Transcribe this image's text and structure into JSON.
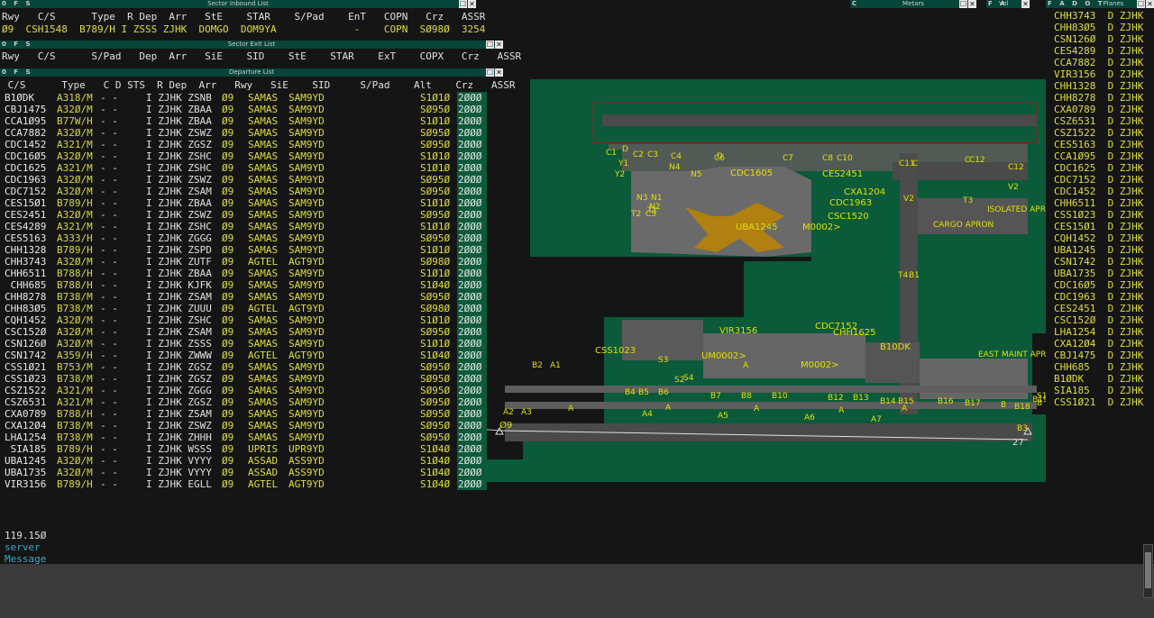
{
  "windows": {
    "inbound": {
      "title": "Sector Inbound List",
      "controls": "0 F S"
    },
    "exit": {
      "title": "Sector Exit List",
      "controls": "0 F S"
    },
    "departure": {
      "title": "Departure List",
      "controls": "0 F S"
    },
    "metars": {
      "title": "Metars",
      "controls": "C"
    },
    "vol": {
      "title": "Vol",
      "controls": "F A"
    },
    "planes": {
      "title": "Planes",
      "controls": "F A D O T"
    },
    "close_glyph": "✕",
    "expand_glyph": "☐"
  },
  "inbound_list": {
    "header": "Rwy   C/S      Type  R Dep  Arr   StE    STAR    S/Pad    EnT   COPN   Crz   ASSR",
    "row": "Ø9  CSH1548  B789/H I ZSSS ZJHK  DOMGO  DOM9YA             -    COPN  SØ98Ø  3254"
  },
  "exit_list": {
    "header": "Rwy   C/S      S/Pad   Dep  Arr   SiE    SID    StE    STAR    ExT    COPX   Crz   ASSR"
  },
  "departure_list": {
    "header": " C/S      Type   C D STS  R Dep  Arr   Rwy   SiE    SID     S/Pad    Alt    Crz   ASSR",
    "rows": [
      [
        "B1ØDK",
        "A318/M",
        "- -",
        "I ZJHK ZSNB",
        "Ø9",
        "SAMAS",
        "SAM9YD",
        "S1Ø1Ø",
        "2ØØØ"
      ],
      [
        "CBJ1475",
        "A32Ø/M",
        "- -",
        "I ZJHK ZBAA",
        "Ø9",
        "SAMAS",
        "SAM9YD",
        "SØ95Ø",
        "2ØØØ"
      ],
      [
        "CCA1Ø95",
        "B77W/H",
        "- -",
        "I ZJHK ZBAA",
        "Ø9",
        "SAMAS",
        "SAM9YD",
        "S1Ø1Ø",
        "2ØØØ"
      ],
      [
        "CCA7882",
        "A32Ø/M",
        "- -",
        "I ZJHK ZSWZ",
        "Ø9",
        "SAMAS",
        "SAM9YD",
        "SØ95Ø",
        "2ØØØ"
      ],
      [
        "CDC1452",
        "A321/M",
        "- -",
        "I ZJHK ZGSZ",
        "Ø9",
        "SAMAS",
        "SAM9YD",
        "SØ95Ø",
        "2ØØØ"
      ],
      [
        "CDC16Ø5",
        "A32Ø/M",
        "- -",
        "I ZJHK ZSHC",
        "Ø9",
        "SAMAS",
        "SAM9YD",
        "S1Ø1Ø",
        "2ØØØ"
      ],
      [
        "CDC1625",
        "A321/M",
        "- -",
        "I ZJHK ZSHC",
        "Ø9",
        "SAMAS",
        "SAM9YD",
        "S1Ø1Ø",
        "2ØØØ"
      ],
      [
        "CDC1963",
        "A32Ø/M",
        "- -",
        "I ZJHK ZSWZ",
        "Ø9",
        "SAMAS",
        "SAM9YD",
        "SØ95Ø",
        "2ØØØ"
      ],
      [
        "CDC7152",
        "A32Ø/M",
        "- -",
        "I ZJHK ZSAM",
        "Ø9",
        "SAMAS",
        "SAM9YD",
        "SØ95Ø",
        "2ØØØ"
      ],
      [
        "CES15Ø1",
        "B789/H",
        "- -",
        "I ZJHK ZBAA",
        "Ø9",
        "SAMAS",
        "SAM9YD",
        "S1Ø1Ø",
        "2ØØØ"
      ],
      [
        "CES2451",
        "A32Ø/M",
        "- -",
        "I ZJHK ZSWZ",
        "Ø9",
        "SAMAS",
        "SAM9YD",
        "SØ95Ø",
        "2ØØØ"
      ],
      [
        "CES4289",
        "A321/M",
        "- -",
        "I ZJHK ZSHC",
        "Ø9",
        "SAMAS",
        "SAM9YD",
        "S1Ø1Ø",
        "2ØØØ"
      ],
      [
        "CES5163",
        "A333/H",
        "- -",
        "I ZJHK ZGGG",
        "Ø9",
        "SAMAS",
        "SAM9YD",
        "SØ95Ø",
        "2ØØØ"
      ],
      [
        "CHH1328",
        "B789/H",
        "- -",
        "I ZJHK ZSPD",
        "Ø9",
        "SAMAS",
        "SAM9YD",
        "S1Ø1Ø",
        "2ØØØ"
      ],
      [
        "CHH3743",
        "A32Ø/M",
        "- -",
        "I ZJHK ZUTF",
        "Ø9",
        "AGTEL",
        "AGT9YD",
        "SØ98Ø",
        "2ØØØ"
      ],
      [
        "CHH6511",
        "B788/H",
        "- -",
        "I ZJHK ZBAA",
        "Ø9",
        "SAMAS",
        "SAM9YD",
        "S1Ø1Ø",
        "2ØØØ"
      ],
      [
        " CHH685",
        "B788/H",
        "- -",
        "I ZJHK KJFK",
        "Ø9",
        "SAMAS",
        "SAM9YD",
        "S1Ø4Ø",
        "2ØØØ"
      ],
      [
        "CHH8278",
        "B738/M",
        "- -",
        "I ZJHK ZSAM",
        "Ø9",
        "SAMAS",
        "SAM9YD",
        "SØ95Ø",
        "2ØØØ"
      ],
      [
        "CHH83Ø5",
        "B738/M",
        "- -",
        "I ZJHK ZUUU",
        "Ø9",
        "AGTEL",
        "AGT9YD",
        "SØ98Ø",
        "2ØØØ"
      ],
      [
        "CQH1452",
        "A32Ø/M",
        "- -",
        "I ZJHK ZSHC",
        "Ø9",
        "SAMAS",
        "SAM9YD",
        "S1Ø1Ø",
        "2ØØØ"
      ],
      [
        "CSC152Ø",
        "A32Ø/M",
        "- -",
        "I ZJHK ZSAM",
        "Ø9",
        "SAMAS",
        "SAM9YD",
        "SØ95Ø",
        "2ØØØ"
      ],
      [
        "CSN126Ø",
        "A32Ø/M",
        "- -",
        "I ZJHK ZSSS",
        "Ø9",
        "SAMAS",
        "SAM9YD",
        "S1Ø1Ø",
        "2ØØØ"
      ],
      [
        "CSN1742",
        "A359/H",
        "- -",
        "I ZJHK ZWWW",
        "Ø9",
        "AGTEL",
        "AGT9YD",
        "S1Ø4Ø",
        "2ØØØ"
      ],
      [
        "CSS1Ø21",
        "B753/M",
        "- -",
        "I ZJHK ZGSZ",
        "Ø9",
        "SAMAS",
        "SAM9YD",
        "SØ95Ø",
        "2ØØØ"
      ],
      [
        "CSS1Ø23",
        "B738/M",
        "- -",
        "I ZJHK ZGSZ",
        "Ø9",
        "SAMAS",
        "SAM9YD",
        "SØ95Ø",
        "2ØØØ"
      ],
      [
        "CSZ1522",
        "A321/M",
        "- -",
        "I ZJHK ZGGG",
        "Ø9",
        "SAMAS",
        "SAM9YD",
        "SØ95Ø",
        "2ØØØ"
      ],
      [
        "CSZ6531",
        "A321/M",
        "- -",
        "I ZJHK ZGSZ",
        "Ø9",
        "SAMAS",
        "SAM9YD",
        "SØ95Ø",
        "2ØØØ"
      ],
      [
        "CXA0789",
        "B788/H",
        "- -",
        "I ZJHK ZSAM",
        "Ø9",
        "SAMAS",
        "SAM9YD",
        "SØ95Ø",
        "2ØØØ"
      ],
      [
        "CXA12Ø4",
        "B738/M",
        "- -",
        "I ZJHK ZSWZ",
        "Ø9",
        "SAMAS",
        "SAM9YD",
        "SØ95Ø",
        "2ØØØ"
      ],
      [
        "LHA1254",
        "B738/M",
        "- -",
        "I ZJHK ZHHH",
        "Ø9",
        "SAMAS",
        "SAM9YD",
        "SØ95Ø",
        "2ØØØ"
      ],
      [
        " SIA185",
        "B789/H",
        "- -",
        "I ZJHK WSSS",
        "Ø9",
        "UPRIS",
        "UPR9YD",
        "S1Ø4Ø",
        "2ØØØ"
      ],
      [
        "UBA1245",
        "A32Ø/M",
        "- -",
        "I ZJHK VYYY",
        "Ø9",
        "ASSAD",
        "ASS9YD",
        "S1Ø4Ø",
        "2ØØØ"
      ],
      [
        "UBA1735",
        "A32Ø/M",
        "- -",
        "I ZJHK VYYY",
        "Ø9",
        "ASSAD",
        "ASS9YD",
        "S1Ø4Ø",
        "2ØØØ"
      ],
      [
        "VIR3156",
        "B789/H",
        "- -",
        "I ZJHK EGLL",
        "Ø9",
        "AGTEL",
        "AGT9YD",
        "S1Ø4Ø",
        "2ØØØ"
      ]
    ]
  },
  "planes": [
    "CHH3743  D ZJHK",
    "CHH83Ø5  D ZJHK",
    "CSN126Ø  D ZJHK",
    "CES4289  D ZJHK",
    "CCA7882  D ZJHK",
    "VIR3156  D ZJHK",
    "CHH1328  D ZJHK",
    "CHH8278  D ZJHK",
    "CXA0789  D ZJHK",
    "CSZ6531  D ZJHK",
    "CSZ1522  D ZJHK",
    "CES5163  D ZJHK",
    "CCA1Ø95  D ZJHK",
    "CDC1625  D ZJHK",
    "CDC7152  D ZJHK",
    "CDC1452  D ZJHK",
    "CHH6511  D ZJHK",
    "CSS1Ø23  D ZJHK",
    "CES15Ø1  D ZJHK",
    "CQH1452  D ZJHK",
    "UBA1245  D ZJHK",
    "CSN1742  D ZJHK",
    "UBA1735  D ZJHK",
    "CDC16Ø5  D ZJHK",
    "CDC1963  D ZJHK",
    "CES2451  D ZJHK",
    "CSC152Ø  D ZJHK",
    "LHA1254  D ZJHK",
    "CXA12Ø4  D ZJHK",
    "CBJ1475  D ZJHK",
    "CHH685   D ZJHK",
    "B1ØDK    D ZJHK",
    "SIA185   D ZJHK",
    "CSS1Ø21  D ZJHK"
  ],
  "map": {
    "labels": {
      "cargo_apron": "CARGO APRON",
      "isolated_apron": "ISOLATED APRON",
      "east_maint_apron": "EAST MAINT APRON",
      "rwy_09": "Ø9",
      "rwy_27": "27",
      "twy": [
        "C1",
        "Y1",
        "Y2",
        "D",
        "C2",
        "C3",
        "C4",
        "N4",
        "N5",
        "N3",
        "N1",
        "N2",
        "T1",
        "T2",
        "C5",
        "C6",
        "D",
        "C7",
        "C8",
        "C10",
        "C11",
        "C",
        "C",
        "C12",
        "C12",
        "V2",
        "V2",
        "T3",
        "T4",
        "B1",
        "B2",
        "A1",
        "A2",
        "A3",
        "A4",
        "A5",
        "A6",
        "A7",
        "B3",
        "B4",
        "B5",
        "B6",
        "B7",
        "B8",
        "B10",
        "B12",
        "B13",
        "B14",
        "B15",
        "B16",
        "B17",
        "B",
        "B18",
        "B19",
        "S1",
        "S2",
        "S3",
        "S4",
        "A",
        "A",
        "A",
        "A",
        "A",
        "A",
        "B"
      ],
      "callsign_tags": [
        "CDC1605",
        "CES2451",
        "CXA1204",
        "CDC1963",
        "CSC1520",
        "UBA1245",
        "M0002>",
        "CDC7152",
        "VIR3156",
        "CHH1625",
        "CSS1023",
        "B10DK",
        "UM0002>",
        "M0002>"
      ]
    }
  },
  "status": {
    "frequency": "119.15Ø",
    "line2": "server",
    "line3": "Message"
  },
  "colors": {
    "background": "#151515",
    "ground": "#0b5a3a",
    "pavement": "#5a5a5a",
    "label": "#e0e000",
    "titlebar": "#05453a"
  }
}
